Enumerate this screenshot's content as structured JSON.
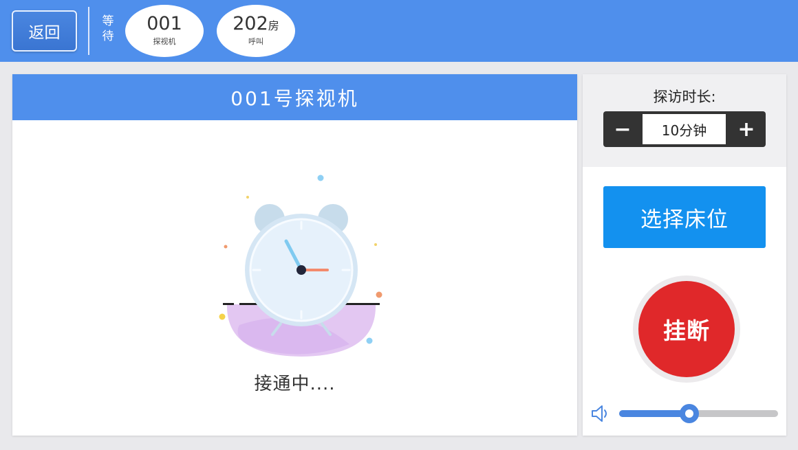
{
  "header": {
    "back_label": "返回",
    "wait_label": "等待",
    "queue": [
      {
        "number": "001",
        "suffix": "",
        "caption": "探视机"
      },
      {
        "number": "202",
        "suffix": "房",
        "caption": "呼叫"
      }
    ]
  },
  "main": {
    "title": "001号探视机",
    "status": "接通中...."
  },
  "side": {
    "duration_label": "探访时长:",
    "minus_symbol": "−",
    "plus_symbol": "+",
    "duration_value": "10分钟",
    "select_bed_label": "选择床位",
    "hangup_label": "挂断",
    "volume_level": 0.44
  },
  "colors": {
    "header_blue": "#4f8fec",
    "select_bed_blue": "#1391ef",
    "hangup_red": "#e0282a"
  },
  "icons": [
    "clock-illustration",
    "speaker-icon"
  ]
}
